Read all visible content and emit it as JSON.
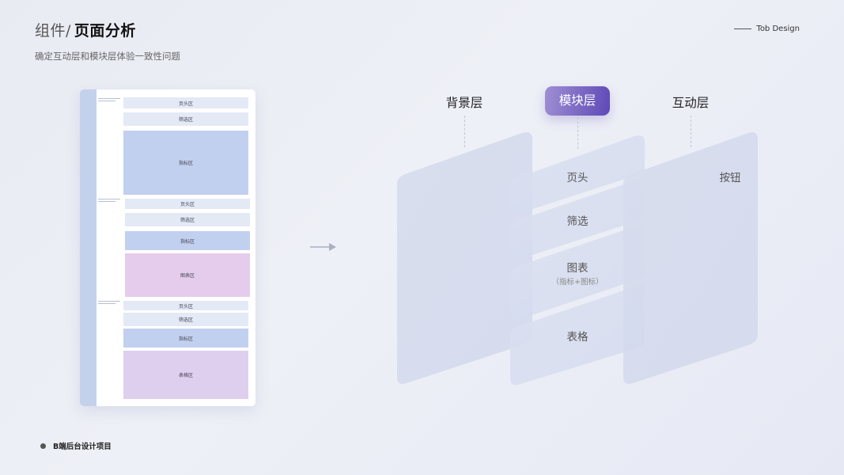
{
  "header": {
    "title_prefix": "组件/",
    "title_main": "页面分析",
    "subtitle": "确定互动层和模块层体验一致性问题",
    "brand": "Tob Design"
  },
  "footer": {
    "project": "B端后台设计项目"
  },
  "wireframe": {
    "section1": {
      "header": "页头区",
      "filter": "筛选区",
      "metric": "指标区"
    },
    "section2": {
      "header": "页头区",
      "filter": "筛选区",
      "metric": "指标区",
      "chart": "图表区"
    },
    "section3": {
      "header": "页头区",
      "filter": "筛选区",
      "metric": "指标区",
      "table": "表格区"
    }
  },
  "diagram": {
    "layers": {
      "background": "背景层",
      "module": "模块层",
      "interactive": "互动层"
    },
    "modules": {
      "header": "页头",
      "filter": "筛选",
      "chart": "图表",
      "chart_sub": "（指标+图标）",
      "table": "表格"
    },
    "interactive": {
      "button": "按钮"
    }
  },
  "colors": {
    "accent_start": "#9f8fd3",
    "accent_end": "#5e49b7",
    "wire_blue": "#c2d0ef",
    "wire_light": "#e4e9f6",
    "wire_pink": "#e5ccec"
  }
}
